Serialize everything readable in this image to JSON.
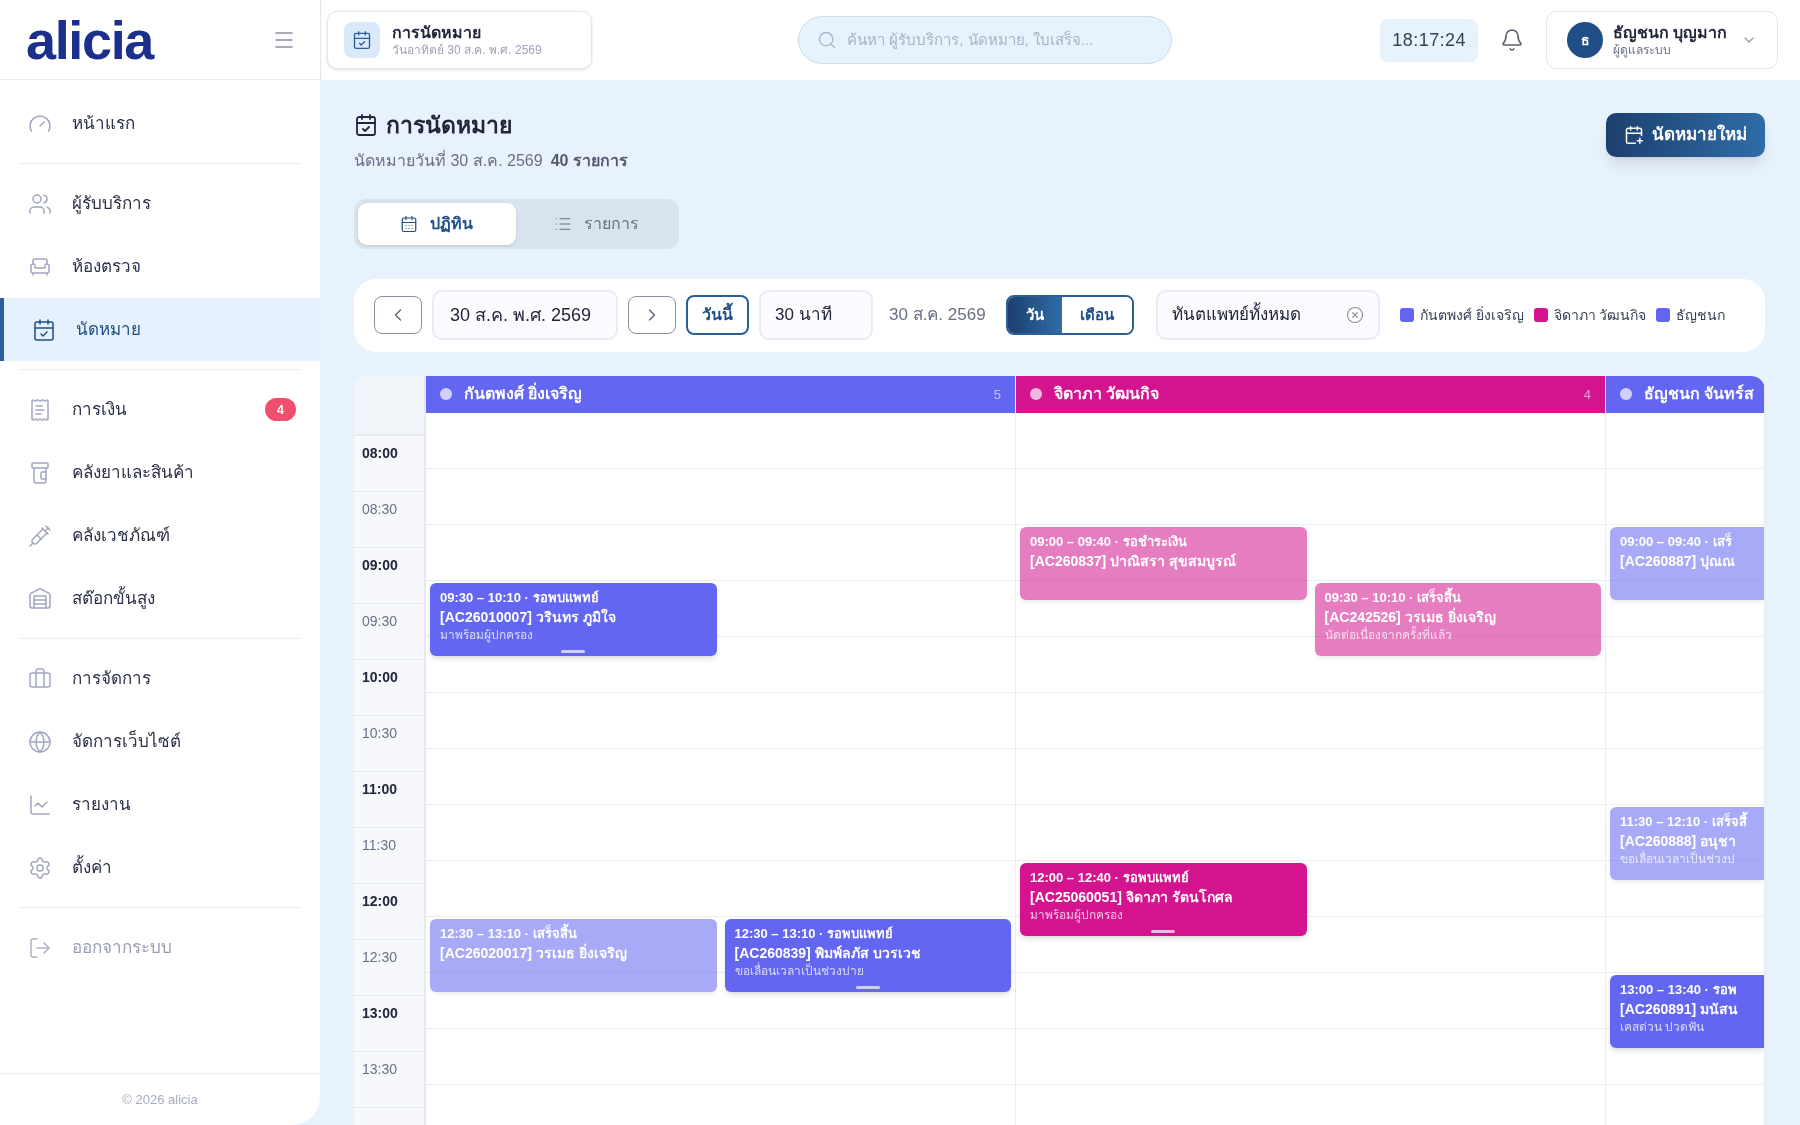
{
  "brand": "alicia",
  "header": {
    "page": {
      "title": "การนัดหมาย",
      "subtitle": "วันอาทิตย์ 30 ส.ค. พ.ศ. 2569"
    },
    "search": {
      "placeholder": "ค้นหา ผู้รับบริการ, นัดหมาย, ใบเสร็จ..."
    },
    "clock": "18:17:24",
    "user": {
      "initial": "ธ",
      "name": "ธัญชนก บุญมาก",
      "role": "ผู้ดูแลระบบ"
    }
  },
  "sidebar": {
    "groups": [
      {
        "items": [
          {
            "label": "หน้าแรก",
            "selected": false
          }
        ]
      },
      {
        "items": [
          {
            "label": "ผู้รับบริการ",
            "selected": false
          },
          {
            "label": "ห้องตรวจ",
            "selected": false
          },
          {
            "label": "นัดหมาย",
            "selected": true
          }
        ]
      },
      {
        "items": [
          {
            "label": "การเงิน",
            "selected": false,
            "badge": "4"
          },
          {
            "label": "คลังยาและสินค้า",
            "selected": false
          },
          {
            "label": "คลังเวชภัณฑ์",
            "selected": false
          },
          {
            "label": "สต๊อกขั้นสูง",
            "selected": false
          }
        ]
      },
      {
        "items": [
          {
            "label": "การจัดการ",
            "selected": false
          },
          {
            "label": "จัดการเว็บไซต์",
            "selected": false
          },
          {
            "label": "รายงาน",
            "selected": false
          },
          {
            "label": "ตั้งค่า",
            "selected": false
          }
        ]
      }
    ],
    "logout": "ออกจากระบบ",
    "footer": "© 2026 alicia"
  },
  "page": {
    "title": "การนัดหมาย",
    "subtitle": "นัดหมายวันที่ 30 ส.ค. 2569",
    "count": "40 รายการ",
    "new_button": "นัดหมายใหม่",
    "views": [
      {
        "label": "ปฏิทิน",
        "selected": true
      },
      {
        "label": "รายการ",
        "selected": false
      }
    ]
  },
  "toolbar": {
    "date": "30 ส.ค. พ.ศ. 2569",
    "today": "วันนี้",
    "interval": "30 นาที",
    "range_label": "30 ส.ค. 2569",
    "modes": [
      {
        "label": "วัน",
        "selected": true
      },
      {
        "label": "เดือน",
        "selected": false
      }
    ],
    "doctor_filter": "ทันตแพทย์ทั้งหมด",
    "legend": [
      {
        "label": "กันตพงศ์ ยิ่งเจริญ",
        "color": "#6366f1"
      },
      {
        "label": "จิดาภา วัฒนกิจ",
        "color": "#d4148f"
      },
      {
        "label": "ธัญชนก",
        "color": "#6366f1"
      }
    ]
  },
  "calendar": {
    "times": [
      "08:00",
      "08:30",
      "09:00",
      "09:30",
      "10:00",
      "10:30",
      "11:00",
      "11:30",
      "12:00",
      "12:30",
      "13:00",
      "13:30"
    ],
    "columns": [
      {
        "doctor": "กันตพงศ์ ยิ่งเจริญ",
        "count": "5",
        "color": "#6366f1",
        "events": [
          {
            "time": "09:30 – 10:10 · รอพบแพทย์",
            "patient": "[AC26010007] วรินทร ภูมิใจ",
            "note": "มาพร้อมผู้ปกครอง",
            "dimmed": false
          },
          {
            "time": "12:30 – 13:10 · เสร็จสิ้น",
            "patient": "[AC26020017] วรเมธ ยิ่งเจริญ",
            "dimmed": true
          },
          {
            "time": "12:30 – 13:10 · รอพบแพทย์",
            "patient": "[AC260839] พิมพ์ลภัส บวรเวช",
            "note": "ขอเลื่อนเวลาเป็นช่วงบ่าย",
            "dimmed": false
          }
        ]
      },
      {
        "doctor": "จิดาภา วัฒนกิจ",
        "count": "4",
        "color": "#d4148f",
        "events": [
          {
            "time": "09:00 – 09:40 · รอชำระเงิน",
            "patient": "[AC260837] ปาณิสรา สุขสมบูรณ์",
            "dimmed": true
          },
          {
            "time": "09:30 – 10:10 · เสร็จสิ้น",
            "patient": "[AC242526] วรเมธ ยิ่งเจริญ",
            "note": "นัดต่อเนื่องจากครั้งที่แล้ว",
            "dimmed": true
          },
          {
            "time": "12:00 – 12:40 · รอพบแพทย์",
            "patient": "[AC25060051] จิดาภา รัตนโกศล",
            "note": "มาพร้อมผู้ปกครอง",
            "dimmed": false
          }
        ]
      },
      {
        "doctor": "ธัญชนก จันทร์ส",
        "color": "#6366f1",
        "events": [
          {
            "time": "09:00 – 09:40 · เสร็",
            "patient": "[AC260887] ปุณณ",
            "dimmed": true
          },
          {
            "time": "11:30 – 12:10 · เสร็จสิ้",
            "patient": "[AC260888] อนุชา",
            "note": "ขอเลื่อนเวลาเป็นช่วงบ่",
            "dimmed": true
          },
          {
            "time": "13:00 – 13:40 · รอพ",
            "patient": "[AC260891] มนัสน",
            "note": "เคสด่วน ปวดฟัน",
            "dimmed": false
          }
        ]
      }
    ]
  }
}
